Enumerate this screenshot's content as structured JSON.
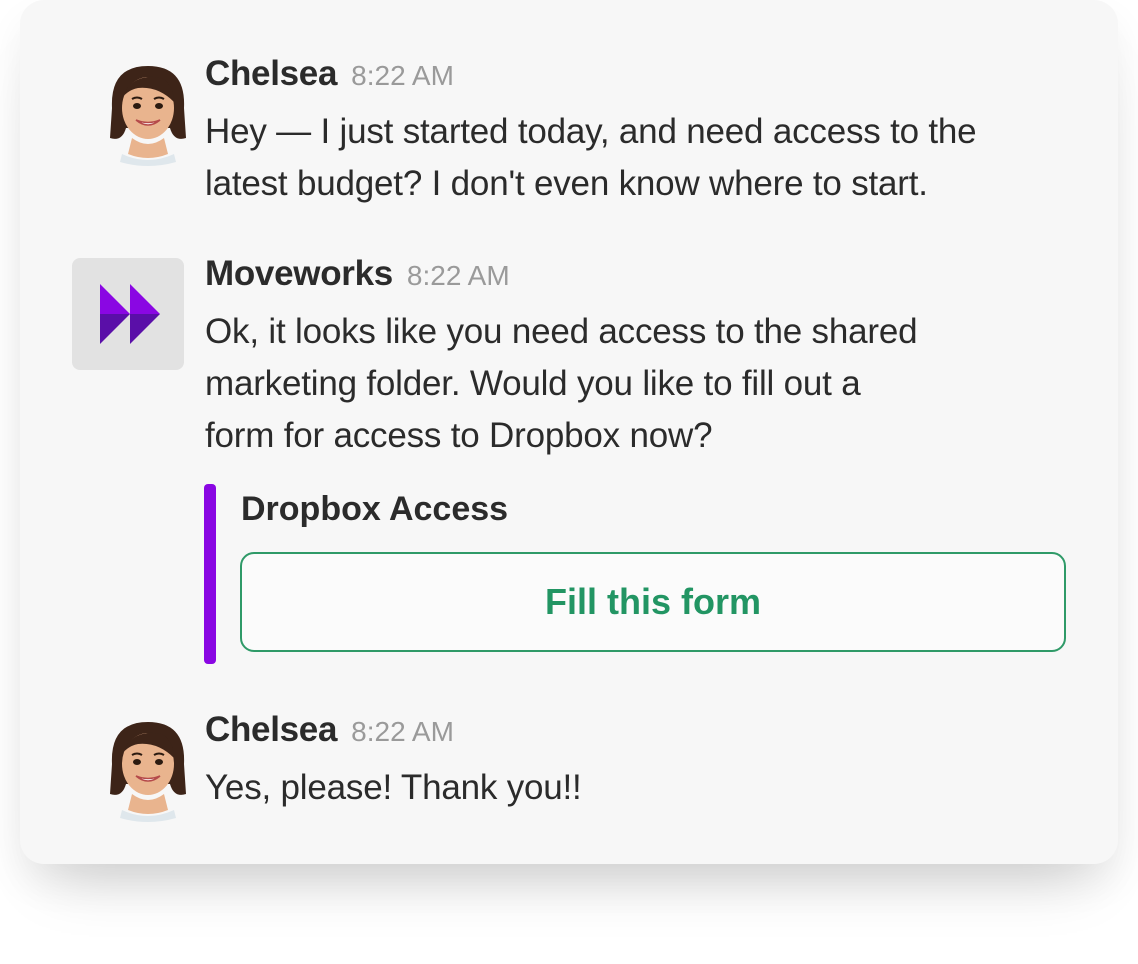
{
  "messages": [
    {
      "name": "Chelsea",
      "time": "8:22 AM",
      "lines": [
        "Hey — I just started today, and need access to the",
        "latest budget? I don't even know where to start."
      ]
    },
    {
      "name": "Moveworks",
      "time": "8:22 AM",
      "lines": [
        "Ok, it looks like you need access to the shared",
        "marketing folder. Would you like to fill out a",
        "form for access to Dropbox now?"
      ],
      "attachment": {
        "title": "Dropbox Access",
        "button_label": "Fill this form"
      }
    },
    {
      "name": "Chelsea",
      "time": "8:22 AM",
      "lines": [
        "Yes, please! Thank you!!"
      ]
    }
  ],
  "colors": {
    "accent_bar": "#8a07e3",
    "button_green": "#229563",
    "logo_purple": "#8a07e3",
    "logo_dark_purple": "#5a0fa8"
  },
  "icons": {
    "user_avatar": "chelsea-bitmoji-avatar-icon",
    "bot_avatar": "moveworks-logo-icon"
  }
}
